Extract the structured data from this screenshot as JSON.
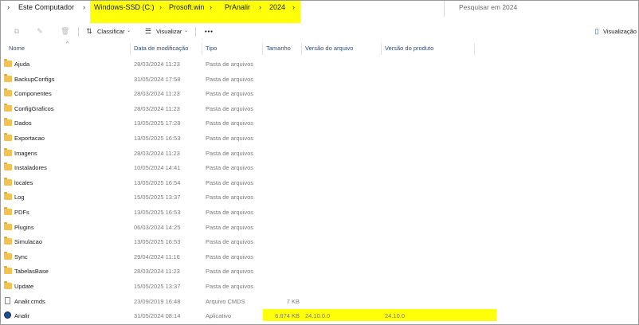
{
  "breadcrumb": {
    "root": "Este Computador",
    "drive": "Windows-SSD (C:)",
    "folder1": "Prosoft.win",
    "folder2": "PrAnalir",
    "folder3": "2024"
  },
  "search": {
    "placeholder": "Pesquisar em 2024"
  },
  "toolbar": {
    "sort_label": "Classificar",
    "view_label": "Visualizar",
    "more_label": "•••",
    "preview_label": "Visualização"
  },
  "columns": {
    "name": "Nome",
    "date": "Data de modificação",
    "type": "Tipo",
    "size": "Tamanho",
    "file_version": "Versão do arquivo",
    "product_version": "Versão do produto"
  },
  "files": [
    {
      "name": "Ajuda",
      "date": "28/03/2024 11:23",
      "type": "Pasta de arquivos",
      "size": "",
      "fver": "",
      "pver": "",
      "icon": "folder-icon"
    },
    {
      "name": "BackupConfigs",
      "date": "31/05/2024 17:58",
      "type": "Pasta de arquivos",
      "size": "",
      "fver": "",
      "pver": "",
      "icon": "folder-icon"
    },
    {
      "name": "Componentes",
      "date": "28/03/2024 11:23",
      "type": "Pasta de arquivos",
      "size": "",
      "fver": "",
      "pver": "",
      "icon": "folder-icon"
    },
    {
      "name": "ConfigGraficos",
      "date": "28/03/2024 11:23",
      "type": "Pasta de arquivos",
      "size": "",
      "fver": "",
      "pver": "",
      "icon": "folder-icon"
    },
    {
      "name": "Dados",
      "date": "13/05/2025 17:28",
      "type": "Pasta de arquivos",
      "size": "",
      "fver": "",
      "pver": "",
      "icon": "folder-icon"
    },
    {
      "name": "Exportacao",
      "date": "13/05/2025 16:53",
      "type": "Pasta de arquivos",
      "size": "",
      "fver": "",
      "pver": "",
      "icon": "folder-icon"
    },
    {
      "name": "Imagens",
      "date": "28/03/2024 11:23",
      "type": "Pasta de arquivos",
      "size": "",
      "fver": "",
      "pver": "",
      "icon": "folder-icon"
    },
    {
      "name": "Instaladores",
      "date": "10/05/2024 14:41",
      "type": "Pasta de arquivos",
      "size": "",
      "fver": "",
      "pver": "",
      "icon": "folder-icon"
    },
    {
      "name": "locales",
      "date": "13/05/2025 16:54",
      "type": "Pasta de arquivos",
      "size": "",
      "fver": "",
      "pver": "",
      "icon": "folder-icon"
    },
    {
      "name": "Log",
      "date": "15/05/2025 13:37",
      "type": "Pasta de arquivos",
      "size": "",
      "fver": "",
      "pver": "",
      "icon": "folder-icon"
    },
    {
      "name": "PDFs",
      "date": "13/05/2025 16:53",
      "type": "Pasta de arquivos",
      "size": "",
      "fver": "",
      "pver": "",
      "icon": "folder-icon"
    },
    {
      "name": "Plugins",
      "date": "06/03/2024 14:25",
      "type": "Pasta de arquivos",
      "size": "",
      "fver": "",
      "pver": "",
      "icon": "folder-icon"
    },
    {
      "name": "Simulacao",
      "date": "13/05/2025 16:53",
      "type": "Pasta de arquivos",
      "size": "",
      "fver": "",
      "pver": "",
      "icon": "folder-icon"
    },
    {
      "name": "Sync",
      "date": "29/04/2024 11:16",
      "type": "Pasta de arquivos",
      "size": "",
      "fver": "",
      "pver": "",
      "icon": "folder-icon"
    },
    {
      "name": "TabelasBase",
      "date": "28/03/2024 11:23",
      "type": "Pasta de arquivos",
      "size": "",
      "fver": "",
      "pver": "",
      "icon": "folder-icon"
    },
    {
      "name": "Update",
      "date": "15/05/2025 13:37",
      "type": "Pasta de arquivos",
      "size": "",
      "fver": "",
      "pver": "",
      "icon": "folder-icon"
    },
    {
      "name": "Analir.cmds",
      "date": "23/09/2019 16:48",
      "type": "Arquivo CMDS",
      "size": "7 KB",
      "fver": "",
      "pver": "",
      "icon": "file-icon"
    },
    {
      "name": "Analir",
      "date": "31/05/2024 08:14",
      "type": "Aplicativo",
      "size": "6.674 KB",
      "fver": "24.10.0.0",
      "pver": "24.10.0",
      "icon": "app-icon"
    }
  ],
  "highlight_color": "#ffff0a"
}
